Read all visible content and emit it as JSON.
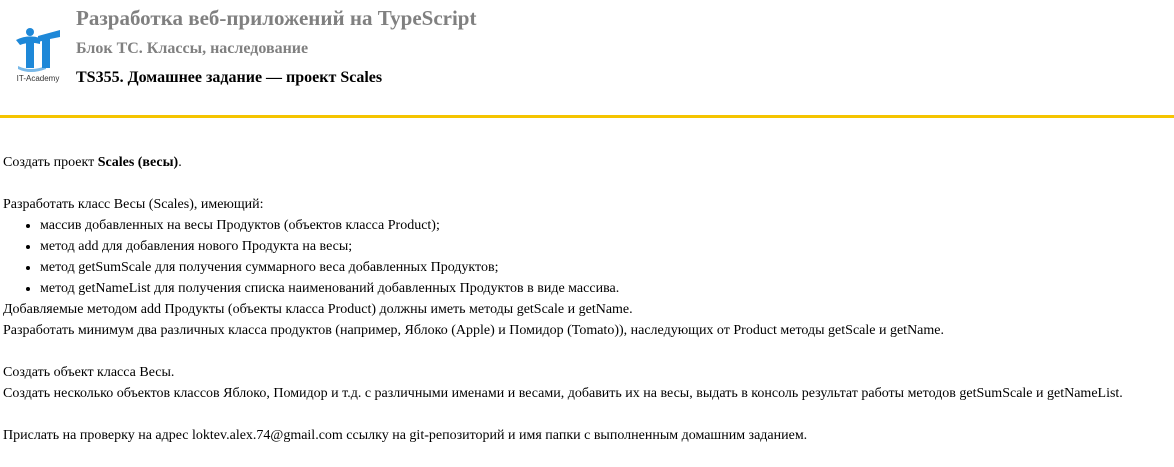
{
  "header": {
    "logo_text": "IT-Academy",
    "course_title": "Разработка веб-приложений на TypeScript",
    "block_title": "Блок TC. Классы, наследование",
    "task_title": "TS355. Домашнее задание — проект Scales"
  },
  "colors": {
    "accent": "#f5c400",
    "logo_blue": "#1e88d8",
    "title_gray": "#808080"
  },
  "content": {
    "p1_prefix": "Создать проект ",
    "p1_bold": "Scales (весы)",
    "p1_suffix": ".",
    "p2": "Разработать класс Весы (Scales), имеющий:",
    "list": [
      "массив добавленных на весы Продуктов (объектов класса Product);",
      "метод add для добавления нового Продукта на весы;",
      "метод getSumScale для получения суммарного веса добавленных Продуктов;",
      "метод getNameList для получения списка наименований добавленных Продуктов в виде массива."
    ],
    "p3": "Добавляемые методом add Продукты (объекты класса Product) должны иметь методы getScale и getName.",
    "p4": "Разработать минимум два различных класса продуктов (например, Яблоко (Apple) и Помидор (Tomato)), наследующих от Product методы getScale и getName.",
    "p5": "Создать объект класса Весы.",
    "p6": "Создать несколько объектов классов Яблоко, Помидор и т.д. с различными именами и весами, добавить их на весы, выдать в консоль результат работы методов getSumScale и getNameList.",
    "p7": "Прислать на проверку на адрес loktev.alex.74@gmail.com ссылку на git-репозиторий и имя папки с выполненным домашним заданием."
  }
}
